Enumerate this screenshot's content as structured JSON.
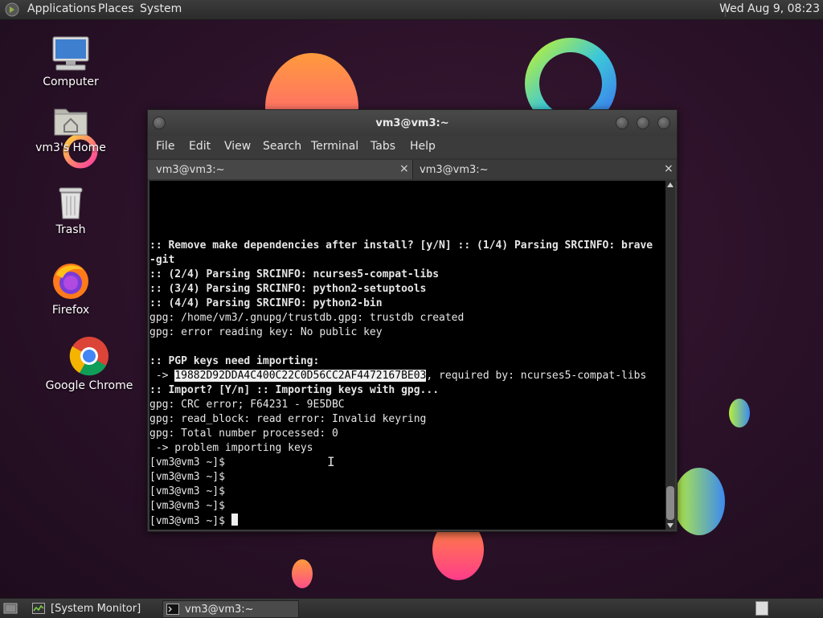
{
  "top_panel": {
    "menus": [
      "Applications",
      "Places",
      "System"
    ],
    "clock": "Wed Aug  9, 08:23",
    "logo_icon": "gnome-foot-icon"
  },
  "desktop": {
    "icons": [
      {
        "label": "Computer",
        "icon": "computer-icon"
      },
      {
        "label": "vm3's Home",
        "icon": "home-folder-icon"
      },
      {
        "label": "Trash",
        "icon": "trash-icon"
      },
      {
        "label": "Firefox",
        "icon": "firefox-icon"
      },
      {
        "label": "Google Chrome",
        "icon": "chrome-icon"
      }
    ]
  },
  "terminal": {
    "title": "vm3@vm3:~",
    "menu": [
      "File",
      "Edit",
      "View",
      "Search",
      "Terminal",
      "Tabs",
      "Help"
    ],
    "tabs": [
      {
        "label": "vm3@vm3:~",
        "close": "×"
      },
      {
        "label": "vm3@vm3:~",
        "close": "×"
      }
    ],
    "lines": [
      {
        "text": ":: Remove make dependencies after install? [y/N] :: (1/4) Parsing SRCINFO: brave",
        "bold": true
      },
      {
        "text": "-git",
        "bold": true
      },
      {
        "text": ":: (2/4) Parsing SRCINFO: ncurses5-compat-libs",
        "bold": true
      },
      {
        "text": ":: (3/4) Parsing SRCINFO: python2-setuptools",
        "bold": true
      },
      {
        "text": ":: (4/4) Parsing SRCINFO: python2-bin",
        "bold": true
      },
      {
        "text": "gpg: /home/vm3/.gnupg/trustdb.gpg: trustdb created",
        "bold": false
      },
      {
        "text": "gpg: error reading key: No public key",
        "bold": false
      },
      {
        "text": "",
        "bold": false
      },
      {
        "text": ":: PGP keys need importing:",
        "bold": true
      },
      {
        "pre": " -> ",
        "highlight": "19882D92DDA4C400C22C0D56CC2AF4472167BE03",
        "post": ", required by: ncurses5-compat-libs"
      },
      {
        "text": ":: Import? [Y/n] :: Importing keys with gpg...",
        "bold": true
      },
      {
        "text": "gpg: CRC error; F64231 - 9E5DBC",
        "bold": false
      },
      {
        "text": "gpg: read_block: read error: Invalid keyring",
        "bold": false
      },
      {
        "text": "gpg: Total number processed: 0",
        "bold": false
      },
      {
        "text": " -> problem importing keys",
        "bold": false
      },
      {
        "text": "[vm3@vm3 ~]$",
        "bold": false
      },
      {
        "text": "[vm3@vm3 ~]$",
        "bold": false
      },
      {
        "text": "[vm3@vm3 ~]$",
        "bold": false
      },
      {
        "text": "[vm3@vm3 ~]$",
        "bold": false
      },
      {
        "text": "[vm3@vm3 ~]$ ",
        "bold": false,
        "cursor": true
      }
    ]
  },
  "bottom_panel": {
    "tasks": [
      {
        "label": "[System Monitor]",
        "icon": "system-monitor-icon"
      },
      {
        "label": "vm3@vm3:~",
        "icon": "terminal-icon"
      }
    ]
  }
}
